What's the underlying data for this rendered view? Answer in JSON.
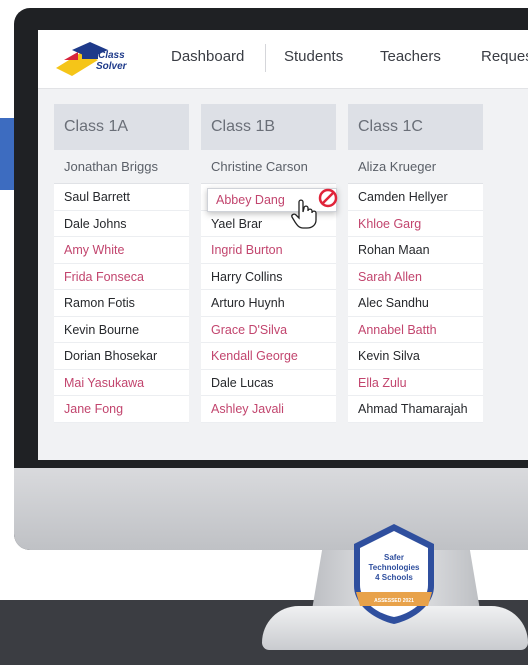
{
  "brand": {
    "logo_line1": "Class",
    "logo_line2": "Solver",
    "logo_icon": "graduation-cap-icon"
  },
  "nav": {
    "items": [
      {
        "label": "Dashboard"
      },
      {
        "label": "Students"
      },
      {
        "label": "Teachers"
      },
      {
        "label": "Reques"
      }
    ]
  },
  "classes": [
    {
      "name": "Class 1A",
      "teacher": "Jonathan Briggs",
      "students": [
        {
          "name": "Saul Barrett",
          "gender": "male"
        },
        {
          "name": "Dale Johns",
          "gender": "male"
        },
        {
          "name": "Amy White",
          "gender": "female"
        },
        {
          "name": "Frida Fonseca",
          "gender": "female"
        },
        {
          "name": "Ramon Fotis",
          "gender": "male"
        },
        {
          "name": "Kevin Bourne",
          "gender": "male"
        },
        {
          "name": "Dorian Bhosekar",
          "gender": "male"
        },
        {
          "name": "Mai Yasukawa",
          "gender": "female"
        },
        {
          "name": "Jane Fong",
          "gender": "female"
        }
      ]
    },
    {
      "name": "Class 1B",
      "teacher": "Christine Carson",
      "students": [
        {
          "name": "",
          "gender": "male"
        },
        {
          "name": "Yael Brar",
          "gender": "male"
        },
        {
          "name": "Ingrid Burton",
          "gender": "female"
        },
        {
          "name": "Harry Collins",
          "gender": "male"
        },
        {
          "name": "Arturo Huynh",
          "gender": "male"
        },
        {
          "name": "Grace D'Silva",
          "gender": "female"
        },
        {
          "name": "Kendall George",
          "gender": "female"
        },
        {
          "name": "Dale Lucas",
          "gender": "male"
        },
        {
          "name": "Ashley Javali",
          "gender": "female"
        }
      ]
    },
    {
      "name": "Class 1C",
      "teacher": "Aliza Krueger",
      "students": [
        {
          "name": "Camden Hellyer",
          "gender": "male"
        },
        {
          "name": "Khloe Garg",
          "gender": "female"
        },
        {
          "name": "Rohan Maan",
          "gender": "male"
        },
        {
          "name": "Sarah Allen",
          "gender": "female"
        },
        {
          "name": "Alec Sandhu",
          "gender": "male"
        },
        {
          "name": "Annabel Batth",
          "gender": "female"
        },
        {
          "name": "Kevin Silva",
          "gender": "male"
        },
        {
          "name": "Ella Zulu",
          "gender": "female"
        },
        {
          "name": "Ahmad Thamarajah",
          "gender": "male"
        }
      ]
    }
  ],
  "dragging": {
    "name": "Abbey Dang",
    "status_icon": "no-entry-icon",
    "cursor_icon": "hand-cursor-icon"
  },
  "badge": {
    "line1": "Safer",
    "line2": "Technologies",
    "line3": "4 Schools",
    "ribbon": "ASSESSED 2021"
  },
  "colors": {
    "female_text": "#c2456e",
    "male_text": "#26282c",
    "header_bg": "#dde0e6",
    "badge_blue": "#2f4f9e",
    "badge_orange": "#e8a24a"
  }
}
